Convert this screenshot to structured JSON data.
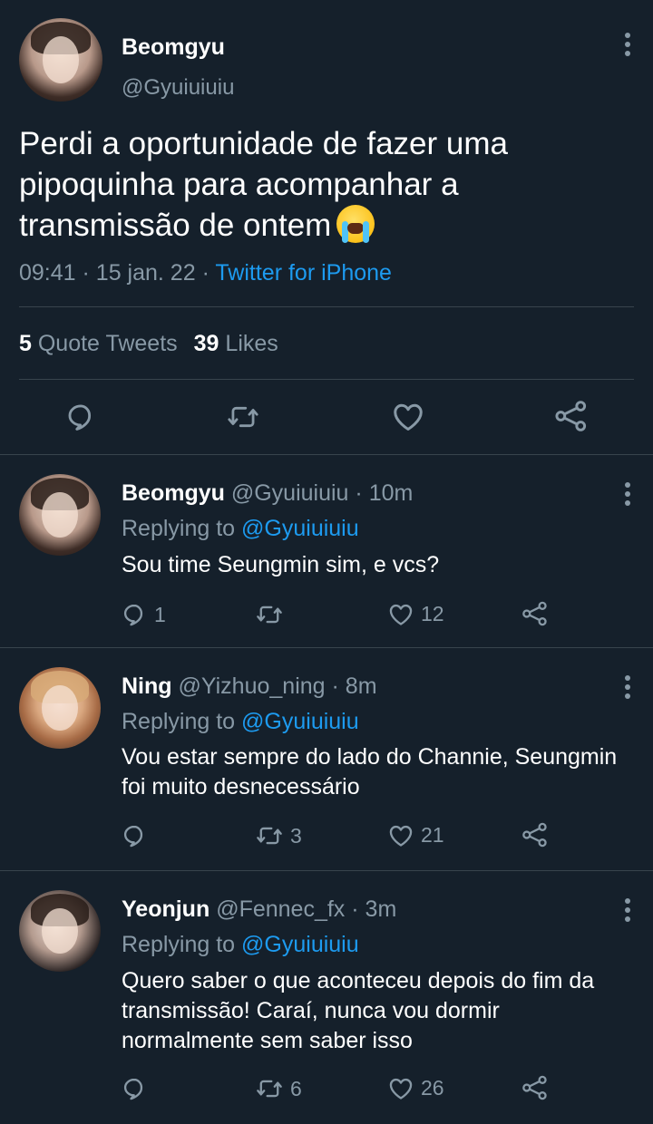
{
  "main_tweet": {
    "display_name": "Beomgyu",
    "handle": "@Gyuiuiuiu",
    "text": "Perdi a oportunidade de fazer uma pipoquinha para acompanhar a transmissão de ontem",
    "emoji": "loudly-crying-face",
    "time": "09:41",
    "date": "15 jan. 22",
    "separator": "·",
    "source": "Twitter for iPhone",
    "quote_tweets_count": "5",
    "quote_tweets_label": "Quote Tweets",
    "likes_count": "39",
    "likes_label": "Likes"
  },
  "replying_to_label": "Replying to",
  "replies": [
    {
      "display_name": "Beomgyu",
      "handle": "@Gyuiuiuiu",
      "time": "· 10m",
      "replying_to": "@Gyuiuiuiu",
      "text": "Sou time Seungmin sim, e vcs?",
      "reply_count": "1",
      "retweet_count": "",
      "like_count": "12"
    },
    {
      "display_name": "Ning",
      "handle": "@Yizhuo_ning",
      "time": "· 8m",
      "replying_to": "@Gyuiuiuiu",
      "text": "Vou estar sempre do lado do Channie, Seungmin foi muito desnecessário",
      "reply_count": "",
      "retweet_count": "3",
      "like_count": "21"
    },
    {
      "display_name": "Yeonjun",
      "handle": "@Fennec_fx",
      "time": "· 3m",
      "replying_to": "@Gyuiuiuiu",
      "text": "Quero saber o que aconteceu depois do fim da transmissão! Caraí, nunca vou dormir normalmente sem saber isso",
      "reply_count": "",
      "retweet_count": "6",
      "like_count": "26"
    }
  ],
  "colors": {
    "background": "#15202b",
    "secondary_text": "#8899a6",
    "accent": "#1d9bf0",
    "divider": "#38444d"
  }
}
